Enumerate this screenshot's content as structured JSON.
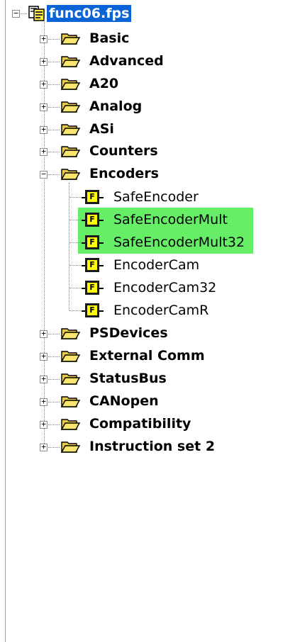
{
  "tree": {
    "root": {
      "label": "func06.fps",
      "selected": true
    },
    "folders": [
      {
        "label": "Basic"
      },
      {
        "label": "Advanced"
      },
      {
        "label": "A20"
      },
      {
        "label": "Analog"
      },
      {
        "label": "ASi"
      },
      {
        "label": "Counters"
      },
      {
        "label": "Encoders",
        "expanded": true,
        "children": [
          {
            "label": "SafeEncoder",
            "highlighted": false
          },
          {
            "label": "SafeEncoderMult",
            "highlighted": true
          },
          {
            "label": "SafeEncoderMult32",
            "highlighted": true
          },
          {
            "label": "EncoderCam",
            "highlighted": false
          },
          {
            "label": "EncoderCam32",
            "highlighted": false
          },
          {
            "label": "EncoderCamR",
            "highlighted": false
          }
        ]
      },
      {
        "label": "PSDevices"
      },
      {
        "label": "External Comm"
      },
      {
        "label": "StatusBus"
      },
      {
        "label": "CANopen"
      },
      {
        "label": "Compatibility"
      },
      {
        "label": "Instruction set 2"
      }
    ],
    "function_block_icon_letter": "F",
    "expander_collapsed": "+",
    "expander_expanded": "−"
  },
  "colors": {
    "selection": "#0a64d6",
    "highlight": "#66ee66",
    "function_block_fill": "#ffff00",
    "folder_fill": "#f5e06a"
  }
}
